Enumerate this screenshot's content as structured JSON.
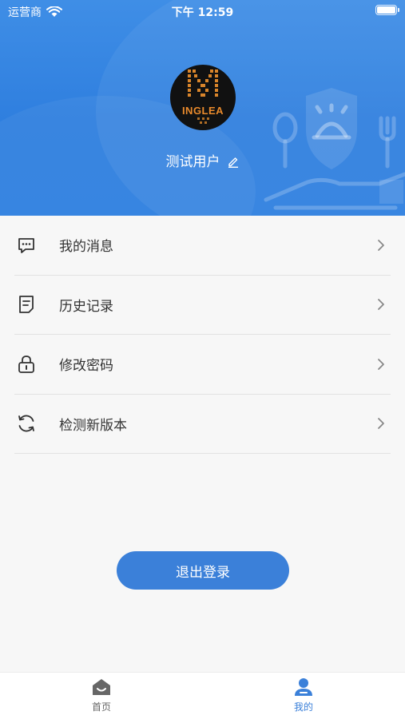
{
  "status_bar": {
    "carrier": "运营商",
    "time": "下午 12:59"
  },
  "profile": {
    "avatar_logo_text": "INGLEA",
    "username": "测试用户"
  },
  "menu": [
    {
      "label": "我的消息",
      "icon": "message-icon"
    },
    {
      "label": "历史记录",
      "icon": "document-icon"
    },
    {
      "label": "修改密码",
      "icon": "lock-icon"
    },
    {
      "label": "检测新版本",
      "icon": "refresh-icon"
    }
  ],
  "logout_label": "退出登录",
  "tabbar": {
    "home_label": "首页",
    "mine_label": "我的"
  },
  "colors": {
    "header_blue": "#2f7fdf",
    "accent": "#3b80d9",
    "background": "#f7f7f7"
  }
}
